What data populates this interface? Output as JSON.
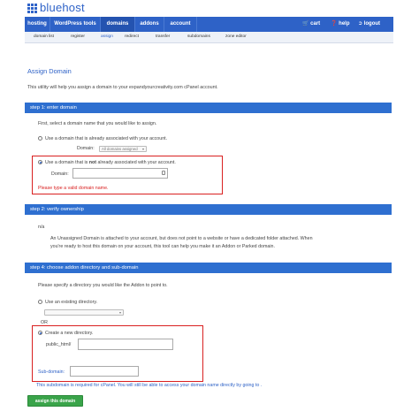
{
  "brand": {
    "name": "bluehost",
    "color": "#2e62c7"
  },
  "nav": {
    "items": [
      {
        "label": "hosting"
      },
      {
        "label": "WordPress tools"
      },
      {
        "label": "domains"
      },
      {
        "label": "addons"
      },
      {
        "label": "account"
      }
    ],
    "cart_label": "cart",
    "help_label": "help",
    "logout_label": "logout"
  },
  "subnav": {
    "items": [
      {
        "label": "domain list"
      },
      {
        "label": "register"
      },
      {
        "label": "assign"
      },
      {
        "label": "redirect"
      },
      {
        "label": "transfer"
      },
      {
        "label": "subdomains"
      },
      {
        "label": "zone editor"
      }
    ]
  },
  "page": {
    "title": "Assign Domain",
    "intro": "This utility will help you assign a domain to your expandyourcreativity.com cPanel account."
  },
  "step1": {
    "header": "step 1: enter domain",
    "instruction": "First, select a domain name that you would like to assign.",
    "option_existing": "Use a domain that is already associated with your account.",
    "domain_label_1": "Domain:",
    "domain_select_value": "All domains assigned",
    "option_new_pre": "Use a domain that is ",
    "option_new_strong": "not",
    "option_new_post": " already associated with your account.",
    "domain_label_2": "Domain:",
    "domain_input_value": "",
    "error": "Please type a valid domain name."
  },
  "step2": {
    "header": "step 2: verify ownership",
    "na": "n/a",
    "desc_line1": "An Unassigned Domain is attached to your account, but does not point to a website or have a dedicated folder attached. When",
    "desc_line2": "you're ready to host this domain on your account, this tool can help you make it an Addon or Parked domain."
  },
  "step4": {
    "header": "step 4: choose addon directory and sub-domain",
    "instruction": "Please specify a directory you would like the Addon to point to.",
    "option_existing_dir": "Use an existing directory.",
    "or_label": "OR",
    "option_new_dir": "Create a new directory.",
    "public_html_label": "public_html/",
    "public_html_value": "",
    "subdomain_label": "Sub-domain:",
    "subdomain_value": "",
    "note": "This subdomain is required for cPanel. You will still be able to access your domain name directly by going to ."
  },
  "submit_label": "assign this domain"
}
